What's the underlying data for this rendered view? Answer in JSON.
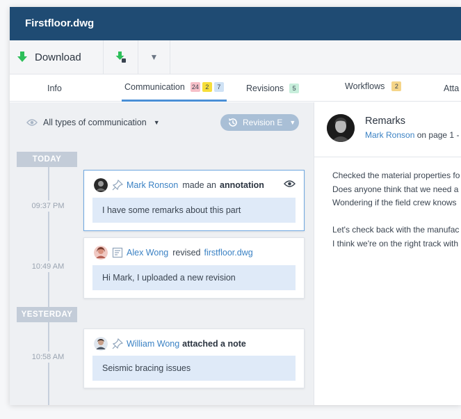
{
  "window": {
    "title": "Firstfloor.dwg"
  },
  "toolbar": {
    "download_label": "Download"
  },
  "tabs": [
    {
      "label": "Info"
    },
    {
      "label": "Communication",
      "badges": [
        "24",
        "2",
        "7"
      ]
    },
    {
      "label": "Revisions",
      "badges": [
        "5"
      ]
    },
    {
      "label": "Workflows",
      "badges": [
        "2"
      ]
    },
    {
      "label": "Atta"
    }
  ],
  "filter": {
    "label": "All types of communication",
    "revision": "Revision E"
  },
  "timeline": {
    "today_label": "TODAY",
    "yesterday_label": "YESTERDAY",
    "times": [
      "09:37 PM",
      "10:49 AM",
      "10:58 AM"
    ]
  },
  "cards": [
    {
      "user": "Mark Ronson",
      "verb": "made an",
      "object": "annotation",
      "body": "I have some remarks about this part"
    },
    {
      "user": "Alex Wong",
      "verb": "revised",
      "object": "firstfloor.dwg",
      "body": "Hi Mark, I uploaded a new revision"
    },
    {
      "user": "William Wong",
      "verb": "attached a note",
      "object": "",
      "body": "Seismic bracing issues"
    }
  ],
  "detail": {
    "title": "Remarks",
    "user": "Mark Ronson",
    "meta": "on page 1 -",
    "lines": [
      "Checked the material properties fo",
      "Does anyone think that we need a",
      "Wondering if the field crew knows",
      "Let's check back with the manufac",
      "I think we're on the right track with"
    ]
  },
  "colors": {
    "titlebar": "#1f4b73",
    "accent": "#4a8fd6",
    "link": "#3b82c4",
    "download_icon": "#2dbf5a"
  }
}
